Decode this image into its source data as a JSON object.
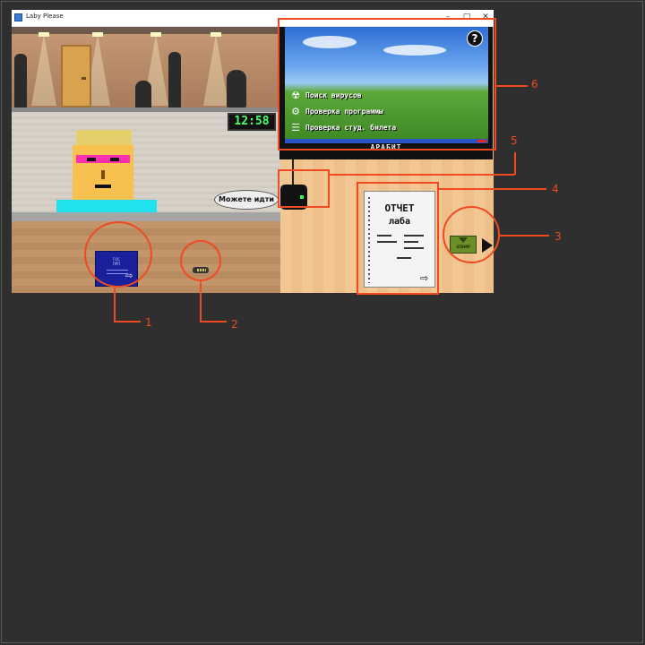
{
  "window": {
    "title": "Laby Please",
    "minimize": "–",
    "maximize": "□",
    "close": "✕"
  },
  "game": {
    "clock": "12:58",
    "speech": "Можете идти",
    "passport": {
      "line1": "ГОС",
      "line2": "ПРП"
    },
    "monitor": {
      "help": "?",
      "menu": [
        {
          "icon": "radiation-icon",
          "glyph": "☢",
          "label": "Поиск вирусов"
        },
        {
          "icon": "gear-icon",
          "glyph": "⚙",
          "label": "Проверка программы"
        },
        {
          "icon": "list-icon",
          "glyph": "☰",
          "label": "Проверка студ. билета"
        }
      ],
      "brand": "АРАБИТ"
    },
    "report": {
      "title": "ОТЧЕТ",
      "subtitle": "лаба",
      "arrow": "⇨"
    },
    "passport_arrow": "⇨",
    "stamp": {
      "label": "STAMP"
    }
  },
  "annotations": [
    "1",
    "2",
    "3",
    "4",
    "5",
    "6"
  ],
  "colors": {
    "annotation": "#f04a23",
    "clock": "#4cff6a",
    "glasses": "#ff2fb0",
    "shirt": "#20e2ef"
  }
}
